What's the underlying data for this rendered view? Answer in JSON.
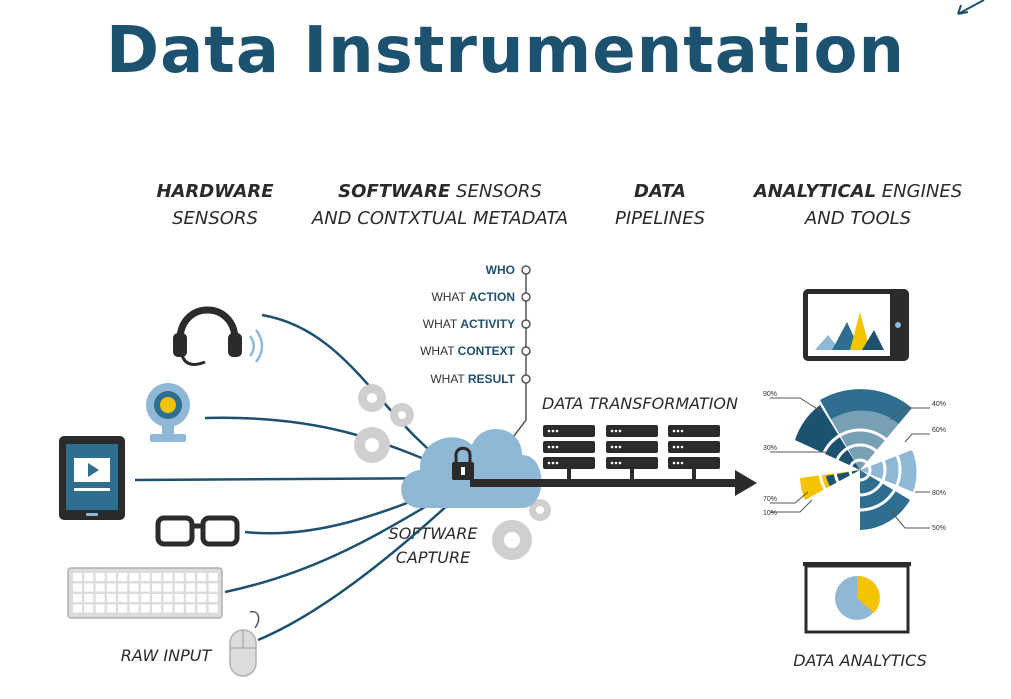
{
  "title": "Data Instrumentation",
  "columns": {
    "hardware": {
      "bold": "HARDWARE",
      "rest": "SENSORS"
    },
    "software": {
      "bold": "SOFTWARE",
      "rest1": " SENSORS",
      "rest2": "AND CONTXTUAL METADATA"
    },
    "pipelines": {
      "bold": "DATA",
      "rest": "PIPELINES"
    },
    "analytical": {
      "bold": "ANALYTICAL",
      "rest1": " ENGINES",
      "rest2": "AND TOOLS"
    }
  },
  "metadata_items": [
    {
      "prefix": "",
      "key": "WHO"
    },
    {
      "prefix": "WHAT ",
      "key": "ACTION"
    },
    {
      "prefix": "WHAT ",
      "key": "ACTIVITY"
    },
    {
      "prefix": "WHAT ",
      "key": "CONTEXT"
    },
    {
      "prefix": "WHAT ",
      "key": "RESULT"
    }
  ],
  "labels": {
    "data_transformation": "DATA TRANSFORMATION",
    "software_capture_1": "SOFTWARE",
    "software_capture_2": "CAPTURE",
    "raw_input": "RAW INPUT",
    "data_analytics": "DATA ANALYTICS"
  },
  "radial_labels": [
    "90%",
    "30%",
    "70%",
    "10%",
    "40%",
    "60%",
    "80%",
    "50%"
  ],
  "colors": {
    "navy": "#1d5170",
    "steel": "#2e6e8e",
    "light_blue": "#8fb8d6",
    "yellow": "#f5c400",
    "dark": "#2b2b2b",
    "gear_gray": "#cfcfcf"
  },
  "icons": [
    "headset-icon",
    "webcam-icon",
    "tablet-icon",
    "glasses-icon",
    "keyboard-icon",
    "mouse-icon",
    "cloud-lock-icon",
    "gear-icon",
    "server-rack-icon",
    "monitor-chart-icon",
    "radial-chart-icon",
    "pie-board-icon"
  ]
}
